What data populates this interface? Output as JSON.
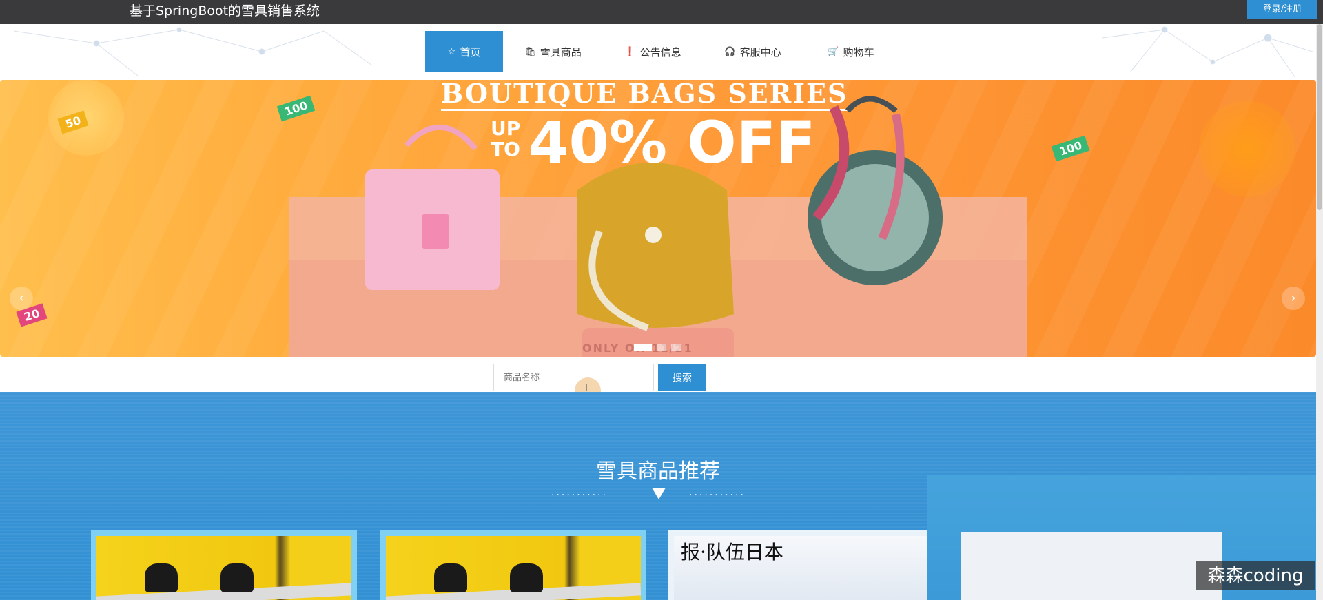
{
  "header": {
    "site_title": "基于SpringBoot的雪具销售系统",
    "login_label": "登录/注册"
  },
  "nav": {
    "items": [
      {
        "label": "首页",
        "icon": "star-icon",
        "active": true
      },
      {
        "label": "雪具商品",
        "icon": "bag-icon",
        "active": false
      },
      {
        "label": "公告信息",
        "icon": "info-icon",
        "active": false
      },
      {
        "label": "客服中心",
        "icon": "headset-icon",
        "active": false
      },
      {
        "label": "购物车",
        "icon": "cart-icon",
        "active": false
      }
    ]
  },
  "banner": {
    "headline": "BOUTIQUE BAGS SERIES",
    "up_to": "UP TO",
    "discount": "40% OFF",
    "footer_text": "ONLY ON 11/21",
    "tags": [
      "50",
      "100",
      "100",
      "20"
    ],
    "slides_count": 3,
    "active_slide": 1
  },
  "search": {
    "placeholder": "商品名称",
    "button_label": "搜索"
  },
  "recommend": {
    "title": "雪具商品推荐",
    "dots": "···········"
  },
  "cards": {
    "handwriting": "报·队伍日本"
  },
  "watermark": "森森coding",
  "colors": {
    "accent": "#2f8fd3",
    "topbar": "#3a3a3c",
    "banner_orange": "#ff9a38",
    "section_blue": "#3290d3"
  }
}
